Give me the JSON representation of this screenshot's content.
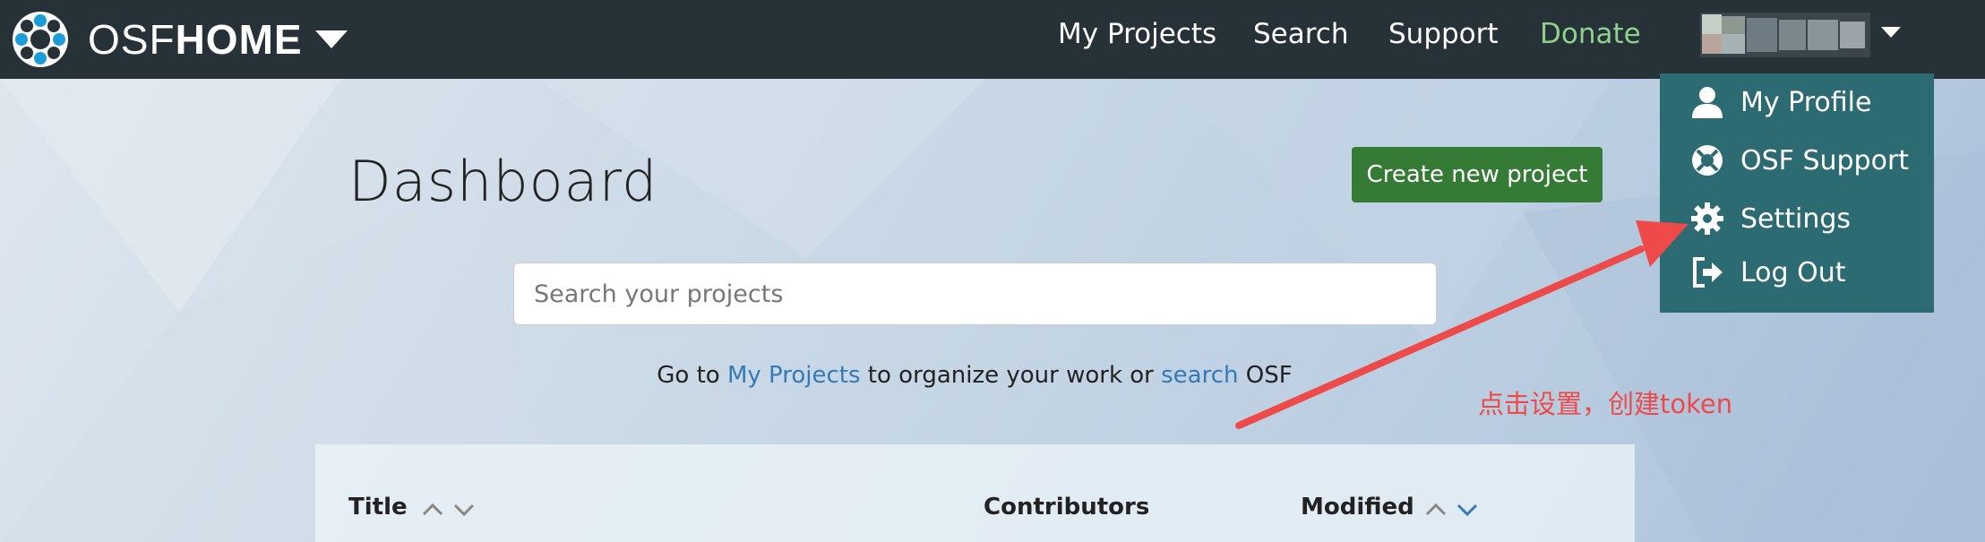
{
  "navbar": {
    "brand_osf": "OSF",
    "brand_home": "HOME",
    "links": [
      "My Projects",
      "Search",
      "Support",
      "Donate"
    ],
    "colors": {
      "background": "#263238",
      "donate": "#8fd18a"
    }
  },
  "user_menu": {
    "items": [
      {
        "label": "My Profile",
        "icon": "user-icon"
      },
      {
        "label": "OSF Support",
        "icon": "lifebuoy-icon"
      },
      {
        "label": "Settings",
        "icon": "gear-icon"
      },
      {
        "label": "Log Out",
        "icon": "logout-icon"
      }
    ],
    "colors": {
      "background": "#2d6b73"
    }
  },
  "dashboard": {
    "title": "Dashboard",
    "create_button": "Create new project",
    "search_placeholder": "Search your projects",
    "goto_prefix": "Go to ",
    "goto_link1": "My Projects",
    "goto_middle": " to organize your work or ",
    "goto_link2": "search",
    "goto_suffix": " OSF",
    "columns": [
      "Title",
      "Contributors",
      "Modified"
    ],
    "colors": {
      "create_button": "#357b36",
      "link": "#337ab7"
    }
  },
  "annotation": {
    "text": "点击设置，创建token",
    "color": "#ef4a4a"
  }
}
